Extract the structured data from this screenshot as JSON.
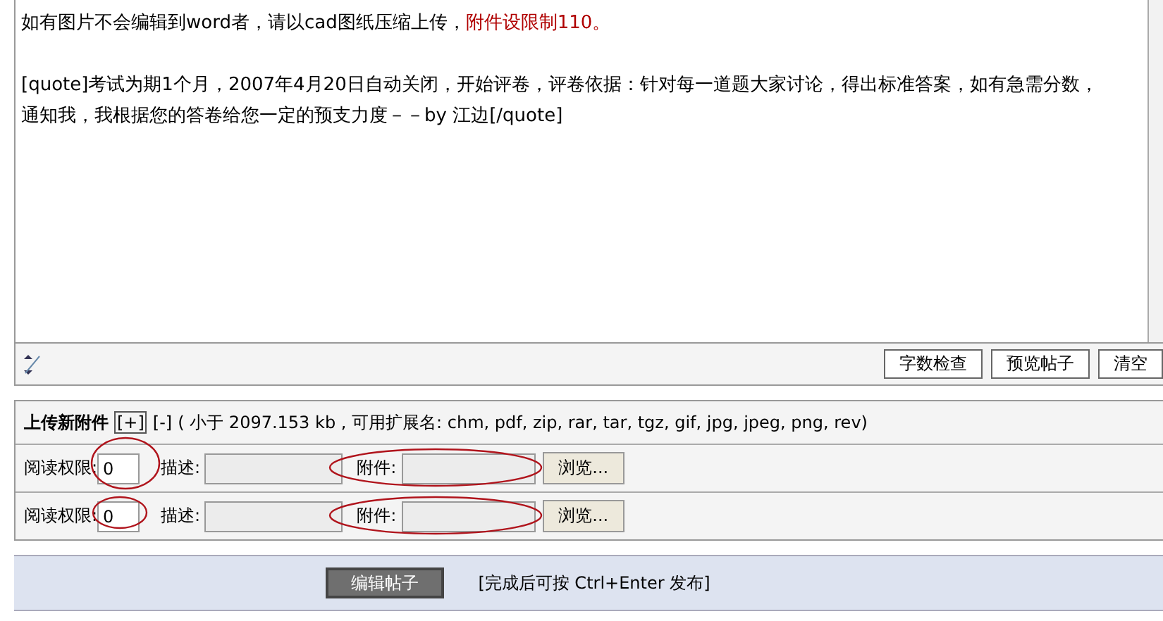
{
  "editor": {
    "paragraphs": [
      {
        "lines": [
          {
            "segments": [
              {
                "text": "如有图片不会编辑到word者，请以cad图纸压缩上传，",
                "kind": "normal"
              },
              {
                "text": "附件设限制110。",
                "kind": "warning"
              }
            ]
          }
        ]
      },
      {
        "lines": [
          {
            "segments": [
              {
                "text": "[quote]考试为期1个月，2007年4月20日自动关闭，开始评卷，评卷依据：针对每一道题大家讨论，得出标准答案，如有急需分数，",
                "kind": "normal"
              }
            ]
          },
          {
            "segments": [
              {
                "text": "通知我，我根据您的答卷给您一定的预支力度－－by 江边[/quote]",
                "kind": "normal"
              }
            ]
          }
        ]
      }
    ]
  },
  "toolbar": {
    "buttons": [
      "字数检查",
      "预览帖子",
      "清空"
    ]
  },
  "upload": {
    "title": "上传新附件",
    "add": "[+]",
    "remove": "[-]",
    "note": "( 小于 2097.153 kb , 可用扩展名: chm, pdf, zip, rar, tar, tgz, gif, jpg, jpeg, png, rev)",
    "rows": [
      {
        "permission_label": "阅读权限:",
        "permission": "0",
        "description_label": "描述:",
        "file_label": "附件:",
        "browse": "浏览...",
        "annotated": true
      },
      {
        "permission_label": "阅读权限:",
        "permission": "0",
        "description_label": "描述:",
        "file_label": "附件:",
        "browse": "浏览...",
        "annotated": true
      }
    ]
  },
  "footer": {
    "submit": "编辑帖子",
    "hint": "[完成后可按 Ctrl+Enter 发布]"
  }
}
